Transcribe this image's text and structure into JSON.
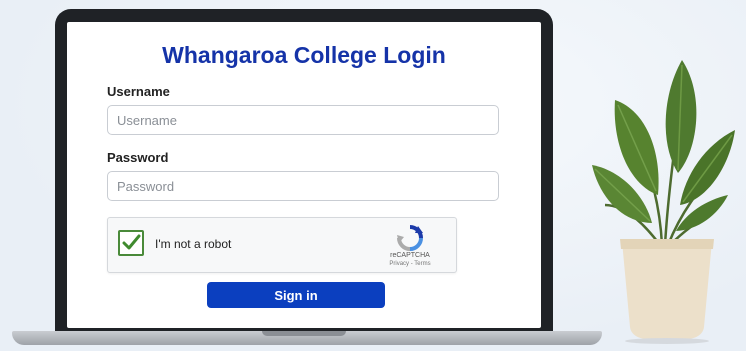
{
  "login": {
    "title": "Whangaroa College Login",
    "username_label": "Username",
    "username_placeholder": "Username",
    "password_label": "Password",
    "password_placeholder": "Password",
    "signin_label": "Sign in"
  },
  "captcha": {
    "label": "I'm not a robot",
    "checked": true,
    "brand": "reCAPTCHA",
    "links": "Privacy - Terms"
  },
  "colors": {
    "title": "#1533a8",
    "button": "#0b3fbf",
    "checkmark": "#3f8a2e",
    "background": "#eef3f8"
  },
  "icons": [
    "checkmark-icon",
    "recaptcha-logo-icon",
    "potted-plant-icon"
  ]
}
